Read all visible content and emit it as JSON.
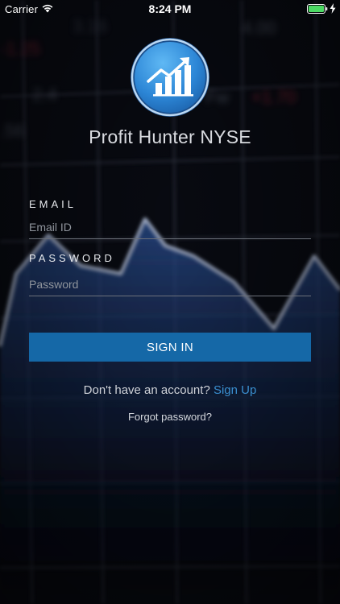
{
  "status_bar": {
    "carrier": "Carrier",
    "time": "8:24 PM",
    "wifi_icon": "wifi-icon",
    "battery_icon": "battery-icon",
    "charging_icon": "charging-bolt-icon"
  },
  "app": {
    "title": "Profit Hunter NYSE",
    "logo_icon": "chart-trend-up-icon"
  },
  "form": {
    "email_label": "EMAIL",
    "email_placeholder": "Email ID",
    "email_value": "",
    "password_label": "PASSWORD",
    "password_placeholder": "Password",
    "password_value": "",
    "signin_label": "SIGN IN"
  },
  "footer": {
    "no_account_text": "Don't have an account?",
    "signup_label": "Sign Up",
    "forgot_label": "Forgot password?"
  },
  "colors": {
    "accent": "#1568a7",
    "link": "#3a8fd0",
    "background": "#07090f"
  }
}
